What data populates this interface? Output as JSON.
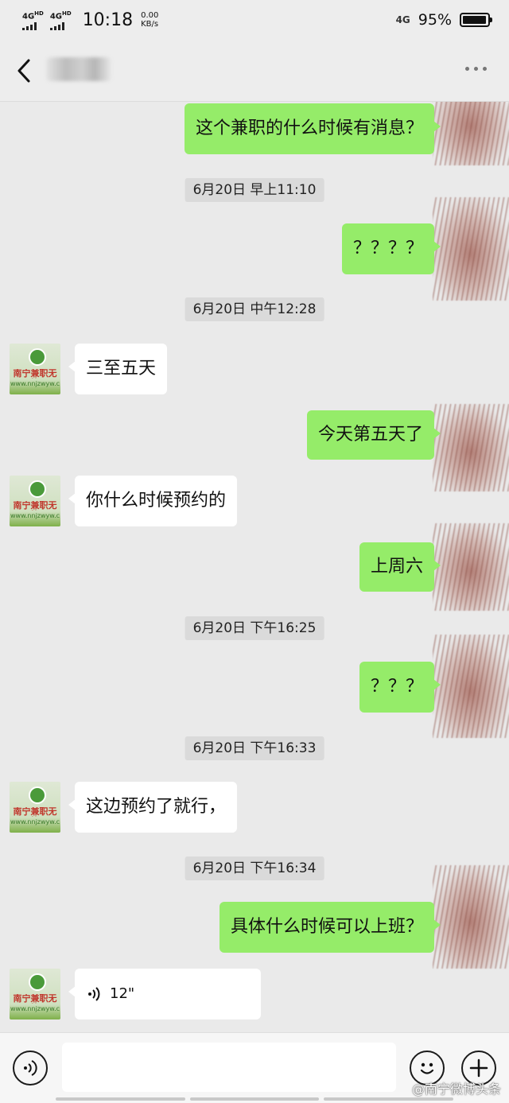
{
  "status_bar": {
    "network_1": "4G",
    "network_1_sup": "HD",
    "network_2": "4G",
    "network_2_sup": "HD",
    "time": "10:18",
    "speed_value": "0.00",
    "speed_unit": "KB/s",
    "signal_label": "4G",
    "battery_percent": "95%",
    "battery_level": 0.95
  },
  "nav": {
    "back_icon": "chevron-left-icon",
    "more_icon": "more-dots-icon"
  },
  "messages": [
    {
      "type": "sent",
      "text": "这个兼职的什么时候有消息？"
    },
    {
      "type": "time",
      "text": "6月20日 早上11:10"
    },
    {
      "type": "sent",
      "text": "？？？？"
    },
    {
      "type": "time",
      "text": "6月20日 中午12:28"
    },
    {
      "type": "received",
      "text": "三至五天"
    },
    {
      "type": "sent",
      "text": "今天第五天了"
    },
    {
      "type": "received",
      "text": "你什么时候预约的"
    },
    {
      "type": "sent",
      "text": "上周六"
    },
    {
      "type": "time",
      "text": "6月20日 下午16:25"
    },
    {
      "type": "sent",
      "text": "？？？"
    },
    {
      "type": "time",
      "text": "6月20日 下午16:33"
    },
    {
      "type": "received",
      "text": "这边预约了就行，"
    },
    {
      "type": "time",
      "text": "6月20日 下午16:34"
    },
    {
      "type": "sent",
      "text": "具体什么时候可以上班？"
    },
    {
      "type": "received_voice",
      "duration": "12\""
    }
  ],
  "contact_avatar": {
    "line1": "南宁兼职无忧",
    "line2": "www.nnjzwyw.c"
  },
  "input_bar": {
    "voice_icon": "voice-icon",
    "emoji_icon": "emoji-icon",
    "plus_icon": "plus-icon"
  },
  "watermark": "@南宁微博头条",
  "colors": {
    "sent_bubble": "#95ec69",
    "received_bubble": "#ffffff",
    "chat_bg": "#eaeaea"
  }
}
